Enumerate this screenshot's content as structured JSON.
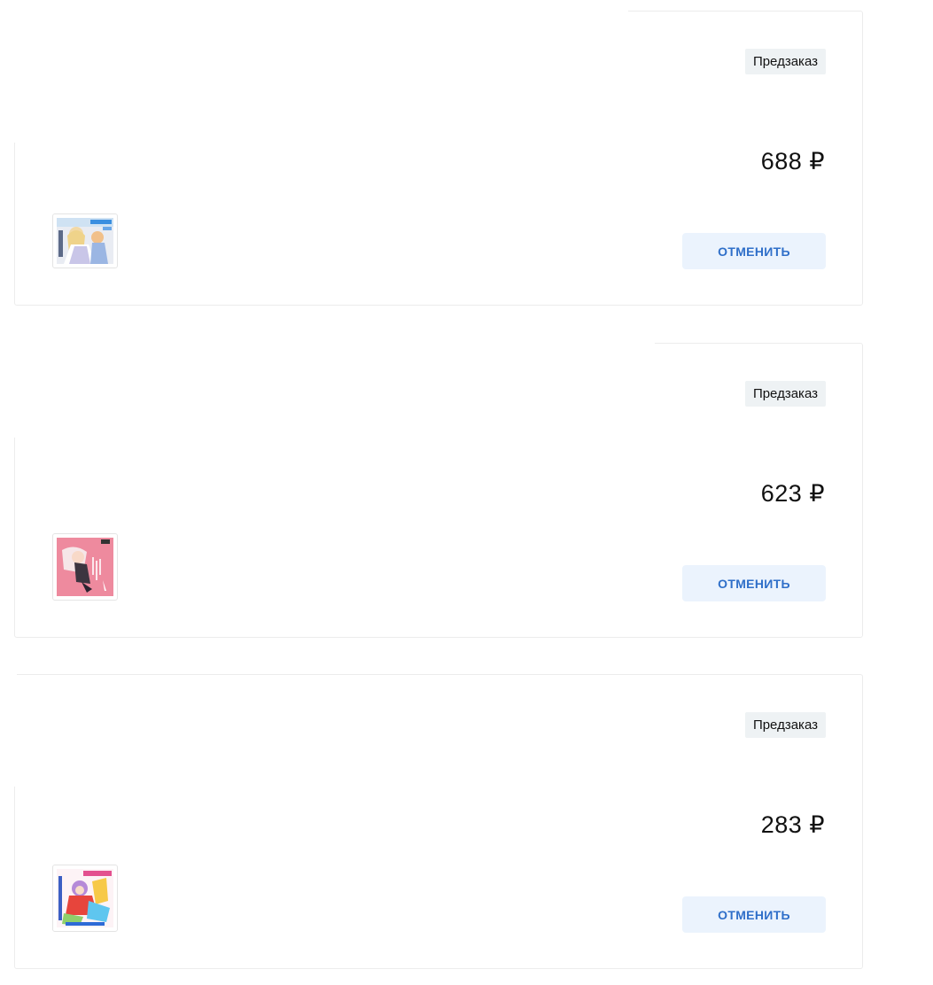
{
  "orders": [
    {
      "badge": "Предзаказ",
      "price": "688 ₽",
      "cancel_label": "ОТМЕНИТЬ",
      "cover": "manga-cover-blue-white"
    },
    {
      "badge": "Предзаказ",
      "price": "623 ₽",
      "cancel_label": "ОТМЕНИТЬ",
      "cover": "manga-cover-pink"
    },
    {
      "badge": "Предзаказ",
      "price": "283 ₽",
      "cancel_label": "ОТМЕНИТЬ",
      "cover": "manga-cover-colorful"
    }
  ],
  "colors": {
    "badge_bg": "#eef2f4",
    "button_bg": "#ebf3fd",
    "button_text": "#2f6fc9",
    "card_border": "#ececec"
  }
}
